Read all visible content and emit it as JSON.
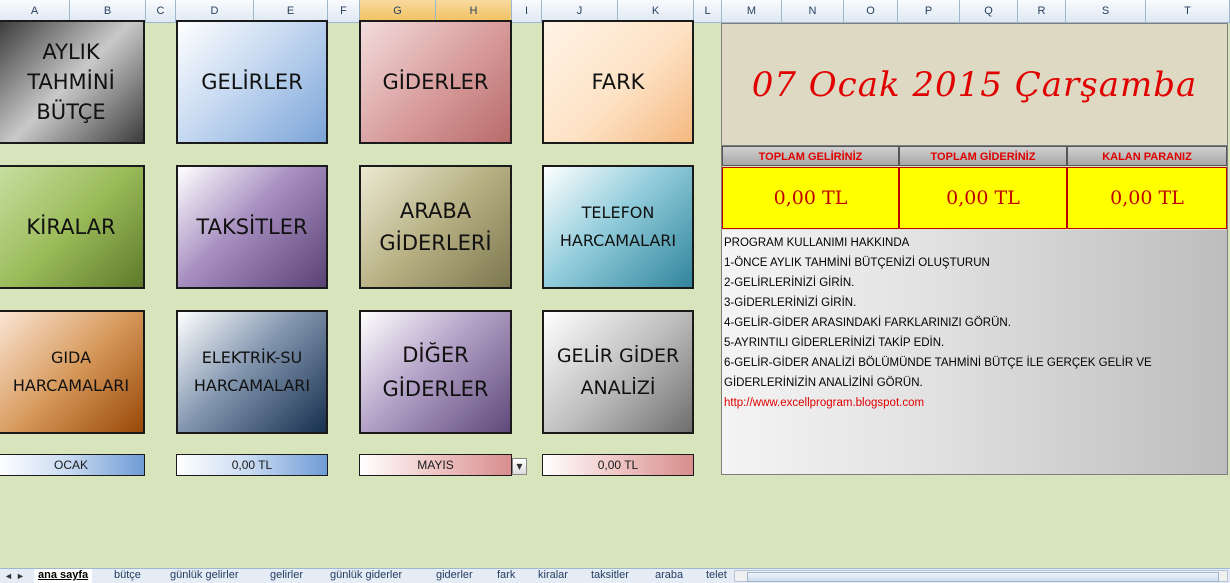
{
  "columns": [
    "A",
    "B",
    "C",
    "D",
    "E",
    "F",
    "G",
    "H",
    "I",
    "J",
    "K",
    "L",
    "M",
    "N",
    "O",
    "P",
    "Q",
    "R",
    "S",
    "T"
  ],
  "buttons": {
    "aylik_tahmini_butce": [
      "AYLIK",
      "TAHMİNİ",
      "BÜTÇE"
    ],
    "gelirler": [
      "GELİRLER"
    ],
    "giderler": [
      "GİDERLER"
    ],
    "fark": [
      "FARK"
    ],
    "kiralar": [
      "KİRALAR"
    ],
    "taksitler": [
      "TAKSİTLER"
    ],
    "araba_giderleri": [
      "ARABA",
      "GİDERLERİ"
    ],
    "telefon_harcamalari": [
      "TELEFON",
      "HARCAMALARI"
    ],
    "gida_harcamalari": [
      "GIDA",
      "HARCAMALARI"
    ],
    "elektrik_su_harcamalari": [
      "ELEKTRİK-SU",
      "HARCAMALARI"
    ],
    "diger_giderler": [
      "DİĞER",
      "GİDERLER"
    ],
    "gelir_gider_analizi": [
      "GELİR GİDER",
      "ANALİZİ"
    ]
  },
  "bottom_bars": {
    "month1": "OCAK",
    "amount1": "0,00 TL",
    "month2": "MAYIS",
    "amount2": "0,00 TL"
  },
  "date_display": "07 Ocak 2015 Çarşamba",
  "summary": {
    "headers": [
      "TOPLAM GELİRİNİZ",
      "TOPLAM GİDERİNİZ",
      "KALAN PARANIZ"
    ],
    "values": [
      "0,00 TL",
      "0,00 TL",
      "0,00 TL"
    ]
  },
  "info": {
    "title": "PROGRAM KULLANIMI HAKKINDA",
    "lines": [
      "1-ÖNCE AYLIK TAHMİNİ BÜTÇENİZİ OLUŞTURUN",
      "2-GELİRLERİNİZİ GİRİN.",
      "3-GİDERLERİNİZİ GİRİN.",
      "4-GELİR-GİDER ARASINDAKİ FARKLARINIZI GÖRÜN.",
      "5-AYRINTILI GİDERLERİNİZİ TAKİP EDİN.",
      "6-GELİR-GİDER ANALİZİ BÖLÜMÜNDE TAHMİNİ BÜTÇE İLE GERÇEK GELİR VE",
      "GİDERLERİNİZİN ANALİZİNİ GÖRÜN."
    ],
    "link": "http://www.excellprogram.blogspot.com"
  },
  "tabs": [
    "ana sayfa",
    "bütçe",
    "günlük gelirler",
    "gelirler",
    "günlük giderler",
    "giderler",
    "fark",
    "kiralar",
    "taksitler",
    "araba",
    "telet"
  ],
  "colors": {
    "sheet_bg": "#d8e4bc",
    "accent_red": "#e00000",
    "highlight_yellow": "#ffff00"
  }
}
